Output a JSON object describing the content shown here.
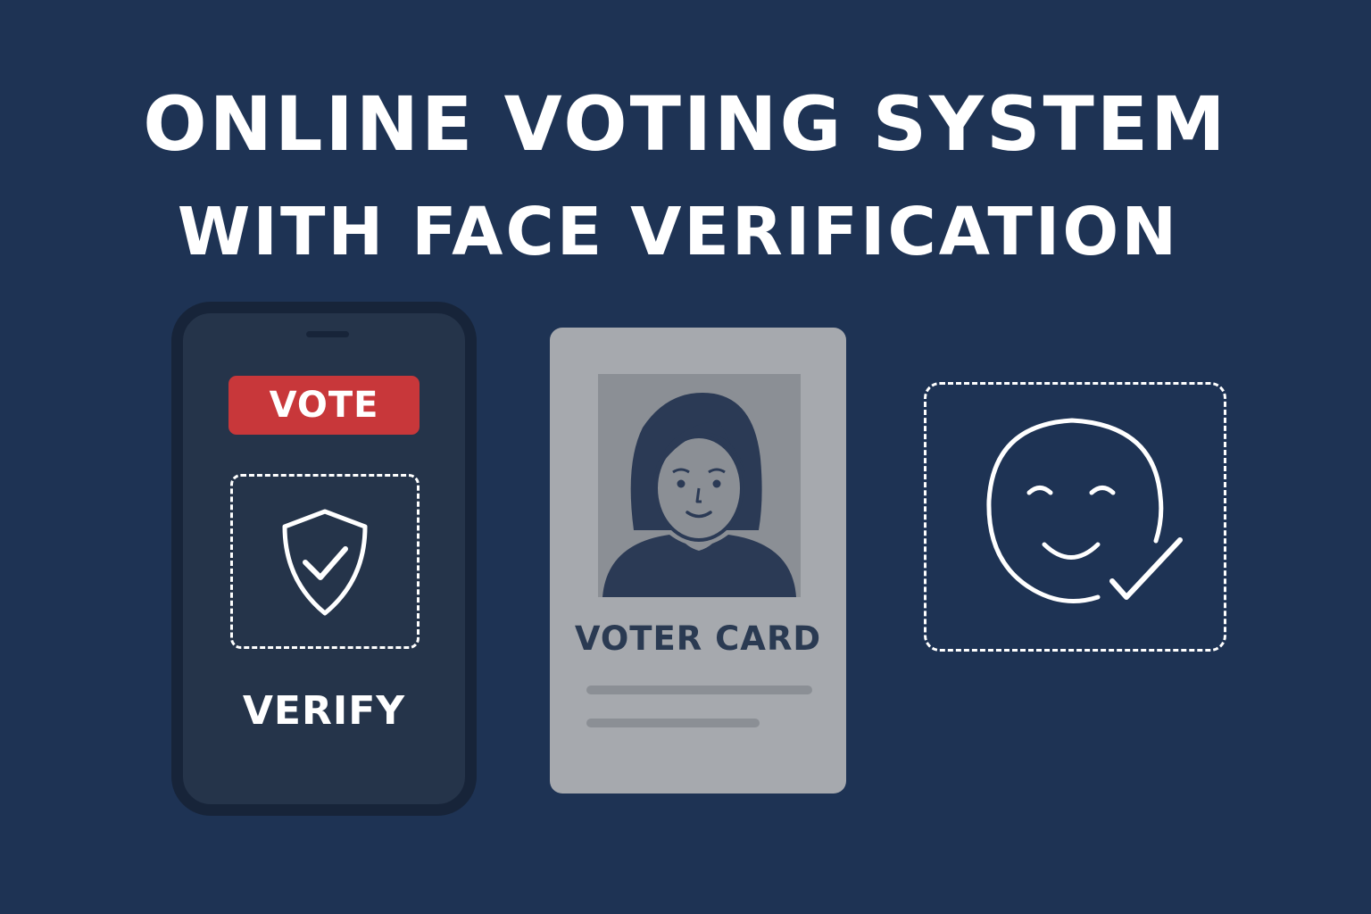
{
  "title": {
    "line1": "ONLINE VOTING SYSTEM",
    "line2": "WITH FACE VERIFICATION"
  },
  "phone": {
    "vote_label": "VOTE",
    "verify_label": "VERIFY"
  },
  "voter_card": {
    "label": "VOTER CARD"
  },
  "colors": {
    "background": "#1e3354",
    "vote_red": "#c8373a",
    "card_gray": "#a6a9ae"
  },
  "icons": [
    "shield-check-icon",
    "woman-portrait-icon",
    "smiley-face-icon",
    "checkmark-icon"
  ]
}
